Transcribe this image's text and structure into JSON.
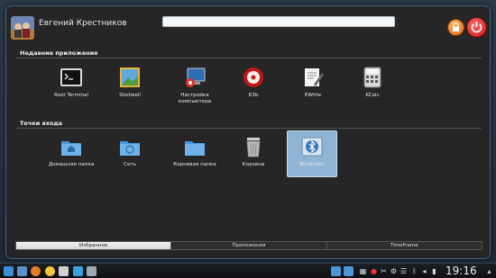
{
  "user": {
    "name": "Евгений Крестников"
  },
  "search": {
    "value": ""
  },
  "sections": {
    "recent": "Недавние приложения",
    "places": "Точки входа"
  },
  "recent_apps": [
    {
      "label": "Root Terminal",
      "icon": "terminal-icon"
    },
    {
      "label": "Shotwell",
      "icon": "shotwell-icon"
    },
    {
      "label": "Настройка компьютера",
      "icon": "system-settings-icon"
    },
    {
      "label": "K3b",
      "icon": "k3b-icon"
    },
    {
      "label": "KWrite",
      "icon": "kwrite-icon"
    },
    {
      "label": "KCalc",
      "icon": "kcalc-icon"
    }
  ],
  "places": [
    {
      "label": "Домашняя папка",
      "icon": "home-folder-icon"
    },
    {
      "label": "Сеть",
      "icon": "network-folder-icon"
    },
    {
      "label": "Корневая папка",
      "icon": "root-folder-icon"
    },
    {
      "label": "Корзина",
      "icon": "trash-icon"
    },
    {
      "label": "Bluetooth",
      "icon": "bluetooth-icon"
    }
  ],
  "tabs": [
    "Избранное",
    "Приложения",
    "TimeFrame"
  ],
  "active_tab": 0,
  "taskbar": {
    "clock": "19:16"
  },
  "colors": {
    "accent": "#8fb4d6",
    "panel": "#262626"
  }
}
